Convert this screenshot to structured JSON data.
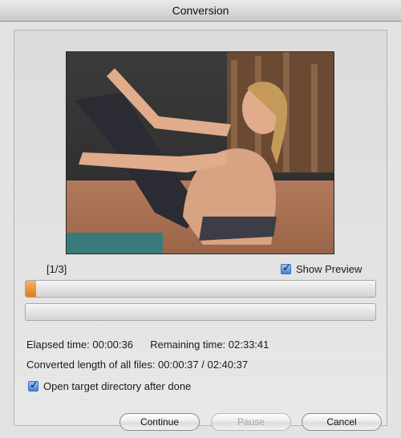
{
  "window": {
    "title": "Conversion"
  },
  "preview": {
    "description_icon": "video-preview-frame"
  },
  "status": {
    "file_counter": "[1/3]",
    "show_preview_label": "Show Preview",
    "show_preview_checked": true
  },
  "progress": {
    "current_file_fraction": 0.004,
    "overall_fraction": 0.0
  },
  "stats": {
    "elapsed": "Elapsed time: 00:00:36",
    "remaining": "Remaining time: 02:33:41",
    "converted": "Converted length of all files: 00:00:37 / 02:40:37"
  },
  "options": {
    "open_dir_label": "Open target directory after done",
    "open_dir_checked": true
  },
  "buttons": {
    "continue": "Continue",
    "pause": "Pause",
    "cancel": "Cancel"
  },
  "colors": {
    "progress_fill": "#e98a2c",
    "checkbox_accent": "#3f82da"
  }
}
